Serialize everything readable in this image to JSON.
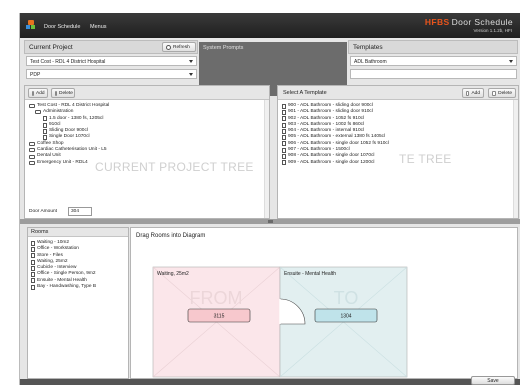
{
  "titlebar": {
    "menu": [
      "Door Schedule",
      "Menus"
    ],
    "brand_accent": "HFBS",
    "brand_text": "Door Schedule",
    "version": "Version 1.1.2b, HFI"
  },
  "current_project": {
    "title": "Current Project",
    "refresh_label": "Refresh",
    "project_value": "Test Cost - RDL 4 District Hospital",
    "subproject_value": "PDP"
  },
  "system_prompts": {
    "label": "System Prompts"
  },
  "templates": {
    "title": "Templates",
    "value": "ADL Bathroom"
  },
  "project_tree": {
    "add_label": "Add",
    "delete_label": "Delete",
    "watermark": "CURRENT PROJECT TREE",
    "items": [
      {
        "label": "Test Cost - RDL 4 District Hospital",
        "type": "folder"
      },
      {
        "label": "Administration",
        "type": "folder"
      },
      {
        "label": "1.5 door - 1380 fs, 1205cl",
        "type": "doc"
      },
      {
        "label": "910cl",
        "type": "doc"
      },
      {
        "label": "Sliding Door 900cl",
        "type": "doc"
      },
      {
        "label": "Single Door 1070cl",
        "type": "doc"
      },
      {
        "label": "Coffee Shop",
        "type": "folder"
      },
      {
        "label": "Cardiac Catheterisation Unit - L5",
        "type": "folder"
      },
      {
        "label": "Dental Unit",
        "type": "folder"
      },
      {
        "label": "Emergency Unit - RDL4",
        "type": "folder"
      }
    ],
    "door_amount_label": "Door Amount",
    "door_amount_value": "304"
  },
  "template_list": {
    "title": "Select A Template",
    "add_label": "Add",
    "delete_label": "Delete",
    "watermark": "TE TREE",
    "items": [
      "900 - ADL Bathroom - sliding door 900cl",
      "901 - ADL Bathroom - sliding door 910cl",
      "902 - ADL Bathroom - 1052 fs 910cl",
      "903 - ADL Bathroom - 1002 fs 860cl",
      "904 - ADL Bathroom - internal 910cl",
      "905 - ADL Bathroom - external 1380 fs 1405cl",
      "906 - ADL Bathroom - single door 1052 fs 910cl",
      "907 - ADL Bathroom - 1500cl",
      "908 - ADL Bathroom - single door 1070cl",
      "909 - ADL Bathroom - single door 1200cl"
    ]
  },
  "rooms": {
    "title": "Rooms",
    "items": [
      "Waiting - 10m2",
      "Office - Workstation",
      "Store - Files",
      "Waiting, 25m2",
      "Cubicle - Interview",
      "Office - Single Person, 9m2",
      "Ensuite - Mental Health",
      "Bay - Handwashing, Type B"
    ]
  },
  "diagram": {
    "title": "Drag Rooms into Diagram",
    "from_room": "Waiting, 25m2",
    "to_room": "Ensuite - Mental Health",
    "from_watermark": "FROM",
    "to_watermark": "TO",
    "from_code": "3115",
    "to_code": "1304",
    "colors": {
      "from_fill": "#fbe6ea",
      "to_fill": "#e2eff0",
      "from_code_fill": "#f7c8cd",
      "to_code_fill": "#bfe3ea"
    }
  },
  "footer": {
    "save_label": "Save"
  }
}
